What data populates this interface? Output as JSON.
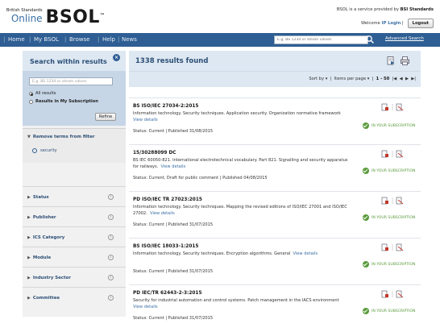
{
  "header": {
    "brand_small": "British Standards",
    "brand_online": "Online",
    "brand_big": "BSOL",
    "brand_tm": "™",
    "provider_prefix": "BSOL is a service provided by",
    "provider_name": "BSI Standards",
    "welcome": "Welcome",
    "login_link": "IP Login",
    "logout": "Logout"
  },
  "nav": {
    "items": [
      "Home",
      "My BSOL",
      "Browse",
      "Help",
      "News"
    ],
    "search_placeholder": "E.g. BS 1234 or steam valves",
    "advanced_search": "Advanced Search"
  },
  "sidebar": {
    "title": "Search within results",
    "search_placeholder": "E.g. BS 1234 or steam valves",
    "scope_options": [
      "All results",
      "Results in My Subscription"
    ],
    "selected_scope": "All results",
    "refine_label": "Refine",
    "remove_terms_title": "Remove terms from filter",
    "active_terms": [
      "security"
    ],
    "facets": [
      "Status",
      "Publisher",
      "ICS Category",
      "Module",
      "Industry Sector",
      "Committee"
    ]
  },
  "results": {
    "count_label": "1338 results found",
    "sort_label": "Sort by",
    "items_per_page_label": "Items per page",
    "range": "1 - 50",
    "subscription_label": "IN YOUR SUBSCRIPTION",
    "view_details": "View details",
    "items": [
      {
        "code": "BS ISO/IEC 27034-2:2015",
        "desc": "Information technology. Security techniques. Application security. Organization normative framework",
        "status": "Status: Current  |  Published 31/08/2015"
      },
      {
        "code": "15/30288099 DC",
        "desc": "BS IEC 60050-821. International electrotechnical vocabulary. Part 821. Signalling and security apparatus for railways.",
        "status": "Status: Current, Draft for public comment  |  Published 04/08/2015"
      },
      {
        "code": "PD ISO/IEC TR 27023:2015",
        "desc": "Information technology. Security techniques. Mapping the revised editions of ISO/IEC 27001 and ISO/IEC 27002.",
        "status": "Status: Current  |  Published 31/07/2015"
      },
      {
        "code": "BS ISO/IEC 18033-1:2015",
        "desc": "Information technology. Security techniques. Encryption algorithms. General",
        "status": "Status: Current  |  Published 31/07/2015"
      },
      {
        "code": "PD IEC/TR 62443-2-3:2015",
        "desc": "Security for industrial automation and control systems. Patch management in the IACS environment",
        "status": "Status: Current  |  Published 31/07/2015"
      }
    ]
  },
  "colors": {
    "nav_bg": "#2e5e93",
    "panel_bg": "#dde8f2",
    "accent_green": "#5a9b3b",
    "link_blue": "#3a6fa5"
  }
}
